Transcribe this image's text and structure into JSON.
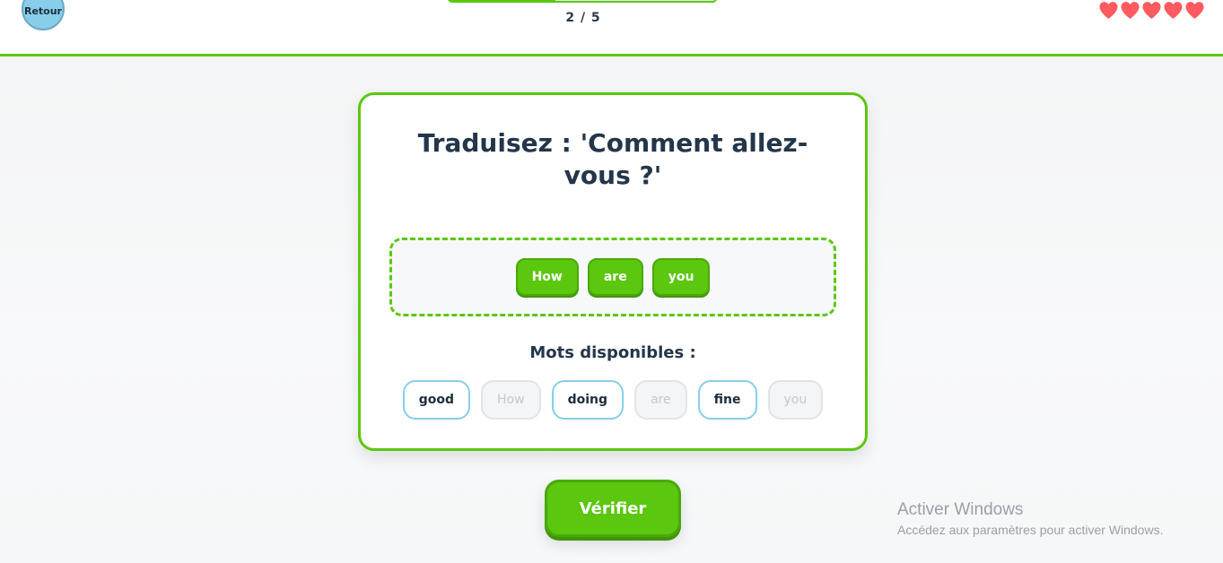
{
  "header": {
    "back_label": "Retour",
    "progress_text": "2 / 5",
    "progress_fraction": 0.4,
    "lives": 5,
    "heart_color": "#ff5a5f"
  },
  "exercise": {
    "question": "Traduisez : 'Comment allez-vous ?'",
    "answer_words": [
      "How",
      "are",
      "you"
    ],
    "available_label": "Mots disponibles :",
    "word_bank": [
      {
        "text": "good",
        "used": false
      },
      {
        "text": "How",
        "used": true
      },
      {
        "text": "doing",
        "used": false
      },
      {
        "text": "are",
        "used": true
      },
      {
        "text": "fine",
        "used": false
      },
      {
        "text": "you",
        "used": true
      }
    ]
  },
  "actions": {
    "verify_label": "Vérifier"
  },
  "watermark": {
    "title": "Activer Windows",
    "subtitle": "Accédez aux paramètres pour activer Windows."
  },
  "colors": {
    "accent": "#5bc70e",
    "back_button": "#87ceeb",
    "text_dark": "#23364a"
  }
}
